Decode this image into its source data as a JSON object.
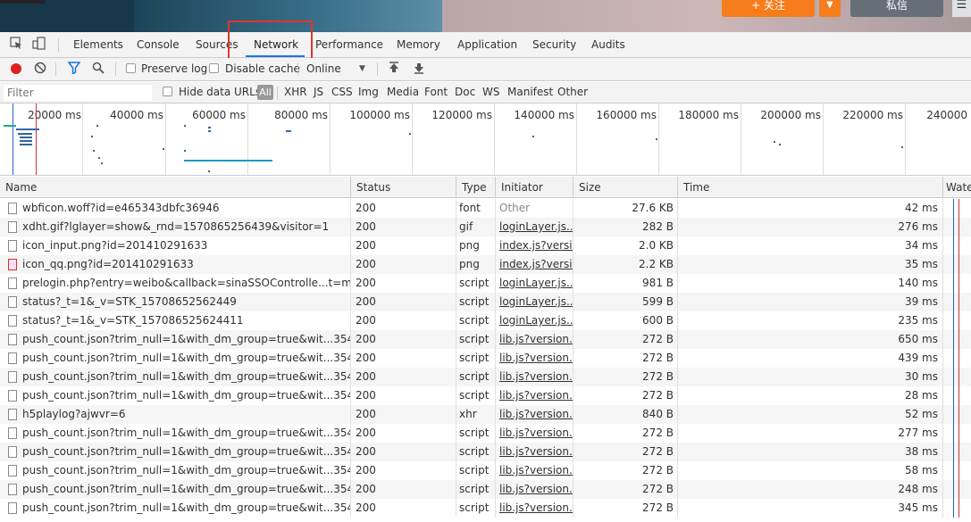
{
  "page": {
    "follow_label": "+ 关注",
    "message_label": "私信",
    "follow_dropdown_icon": "chevron-down-icon",
    "more_icon": "menu-icon"
  },
  "tabs": [
    {
      "label": "Elements"
    },
    {
      "label": "Console"
    },
    {
      "label": "Sources"
    },
    {
      "label": "Network",
      "active": true
    },
    {
      "label": "Performance"
    },
    {
      "label": "Memory"
    },
    {
      "label": "Application"
    },
    {
      "label": "Security"
    },
    {
      "label": "Audits"
    }
  ],
  "toolbar": {
    "preserve_log": "Preserve log",
    "disable_cache": "Disable cache",
    "throttle": "Online",
    "record_color": "#e02020",
    "filter_icon_color": "#1a73e8"
  },
  "filterbar": {
    "placeholder": "Filter",
    "hide_data_urls": "Hide data URLs",
    "types": [
      "All",
      "XHR",
      "JS",
      "CSS",
      "Img",
      "Media",
      "Font",
      "Doc",
      "WS",
      "Manifest",
      "Other"
    ]
  },
  "timeline": {
    "ticks": [
      "20000 ms",
      "40000 ms",
      "60000 ms",
      "80000 ms",
      "100000 ms",
      "120000 ms",
      "140000 ms",
      "160000 ms",
      "180000 ms",
      "200000 ms",
      "220000 ms",
      "240000"
    ]
  },
  "columns": {
    "name": "Name",
    "status": "Status",
    "type": "Type",
    "initiator": "Initiator",
    "size": "Size",
    "time": "Time",
    "waterfall": "Waterfall"
  },
  "requests": [
    {
      "name": "wbficon.woff?id=e465343dbfc36946",
      "status": "200",
      "type": "font",
      "initiator": "Other",
      "size": "27.6 KB",
      "time": "42 ms"
    },
    {
      "name": "xdht.gif?lglayer=show&_rnd=1570865256439&visitor=1",
      "status": "200",
      "type": "gif",
      "initiator": "loginLayer.js...",
      "size": "282 B",
      "time": "276 ms"
    },
    {
      "name": "icon_input.png?id=201410291633",
      "status": "200",
      "type": "png",
      "initiator": "index.js?versi...",
      "size": "2.0 KB",
      "time": "34 ms"
    },
    {
      "name": "icon_qq.png?id=201410291633",
      "status": "200",
      "type": "png",
      "initiator": "index.js?versi...",
      "size": "2.2 KB",
      "time": "35 ms"
    },
    {
      "name": "prelogin.php?entry=weibo&callback=sinaSSOControlle...t=mod&c...",
      "status": "200",
      "type": "script",
      "initiator": "loginLayer.js...",
      "size": "981 B",
      "time": "140 ms"
    },
    {
      "name": "status?_t=1&_v=STK_15708652562449",
      "status": "200",
      "type": "script",
      "initiator": "loginLayer.js...",
      "size": "599 B",
      "time": "39 ms"
    },
    {
      "name": "status?_t=1&_v=STK_157086525624411",
      "status": "200",
      "type": "script",
      "initiator": "loginLayer.js...",
      "size": "600 B",
      "time": "235 ms"
    },
    {
      "name": "push_count.json?trim_null=1&with_dm_group=true&wit...354573...",
      "status": "200",
      "type": "script",
      "initiator": "lib.js?version...",
      "size": "272 B",
      "time": "650 ms"
    },
    {
      "name": "push_count.json?trim_null=1&with_dm_group=true&wit...354573...",
      "status": "200",
      "type": "script",
      "initiator": "lib.js?version...",
      "size": "272 B",
      "time": "439 ms"
    },
    {
      "name": "push_count.json?trim_null=1&with_dm_group=true&wit...354573...",
      "status": "200",
      "type": "script",
      "initiator": "lib.js?version...",
      "size": "272 B",
      "time": "30 ms"
    },
    {
      "name": "push_count.json?trim_null=1&with_dm_group=true&wit...354573...",
      "status": "200",
      "type": "script",
      "initiator": "lib.js?version...",
      "size": "272 B",
      "time": "28 ms"
    },
    {
      "name": "h5playlog?ajwvr=6",
      "status": "200",
      "type": "xhr",
      "initiator": "lib.js?version...",
      "size": "840 B",
      "time": "52 ms"
    },
    {
      "name": "push_count.json?trim_null=1&with_dm_group=true&wit...354573...",
      "status": "200",
      "type": "script",
      "initiator": "lib.js?version...",
      "size": "272 B",
      "time": "277 ms"
    },
    {
      "name": "push_count.json?trim_null=1&with_dm_group=true&wit...354573...",
      "status": "200",
      "type": "script",
      "initiator": "lib.js?version...",
      "size": "272 B",
      "time": "38 ms"
    },
    {
      "name": "push_count.json?trim_null=1&with_dm_group=true&wit...354573...",
      "status": "200",
      "type": "script",
      "initiator": "lib.js?version...",
      "size": "272 B",
      "time": "58 ms"
    },
    {
      "name": "push_count.json?trim_null=1&with_dm_group=true&wit...354573...",
      "status": "200",
      "type": "script",
      "initiator": "lib.js?version...",
      "size": "272 B",
      "time": "248 ms"
    },
    {
      "name": "push_count.json?trim_null=1&with_dm_group=true&wit...354573...",
      "status": "200",
      "type": "script",
      "initiator": "lib.js?version...",
      "size": "272 B",
      "time": "345 ms"
    }
  ]
}
